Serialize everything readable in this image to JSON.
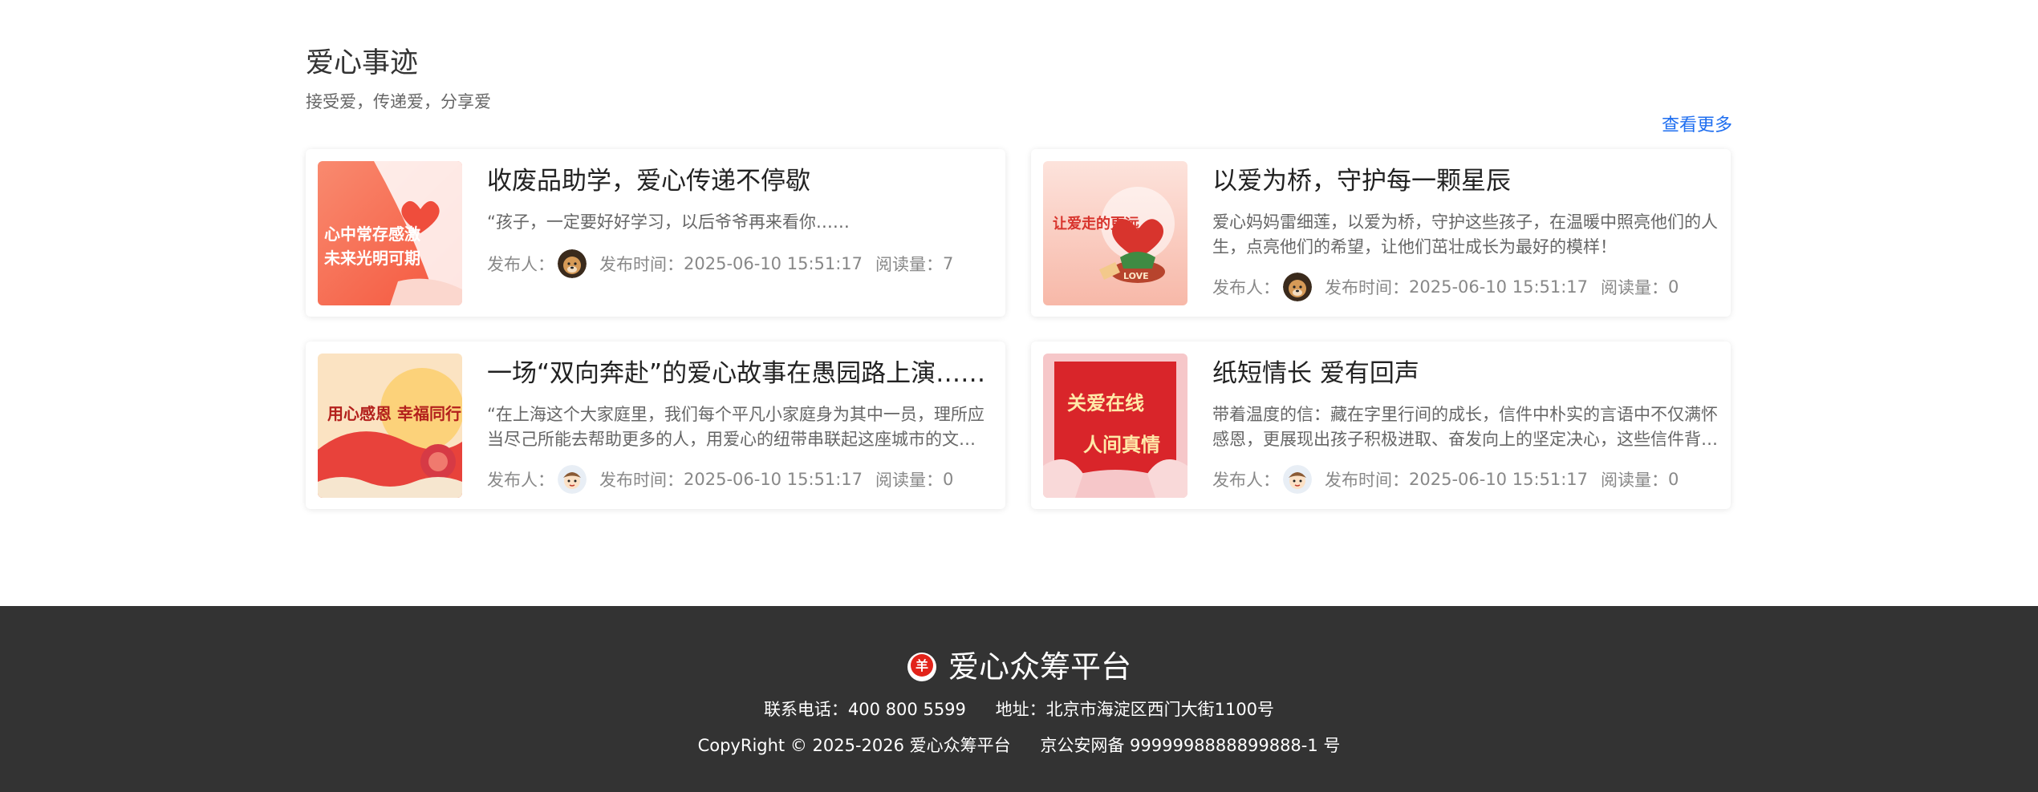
{
  "section": {
    "title": "爱心事迹",
    "subtitle": "接受爱，传递爱，分享爱",
    "more": "查看更多"
  },
  "meta_labels": {
    "author": "发布人：",
    "time": "发布时间：",
    "reads": "阅读量："
  },
  "cards": [
    {
      "title": "收废品助学，爱心传递不停歇",
      "desc": "“孩子，一定要好好学习，以后爷爷再来看你……",
      "time": "2025-06-10 15:51:17",
      "reads": "7",
      "thumb_text": [
        "心中常存感激",
        "未来光明可期"
      ]
    },
    {
      "title": "以爱为桥，守护每一颗星辰",
      "desc": "爱心妈妈雷细莲，以爱为桥，守护这些孩子，在温暖中照亮他们的人生，点亮他们的希望，让他们茁壮成长为最好的模样！",
      "time": "2025-06-10 15:51:17",
      "reads": "0",
      "thumb_text": [
        "让爱走的更远",
        "LOVE"
      ]
    },
    {
      "title": "一场“双向奔赴”的爱心故事在愚园路上演……",
      "desc": "“在上海这个大家庭里，我们每个平凡小家庭身为其中一员，理所应当尽己所能去帮助更多的人，用爱心的纽带串联起这座城市的文明……",
      "time": "2025-06-10 15:51:17",
      "reads": "0",
      "thumb_text": [
        "用心感恩 幸福同行"
      ]
    },
    {
      "title": "纸短情长 爱有回声",
      "desc": "带着温度的信：藏在字里行间的成长，信件中朴实的言语中不仅满怀感恩，更展现出孩子积极进取、奋发向上的坚定决心，这些信件背后……",
      "time": "2025-06-10 15:51:17",
      "reads": "0",
      "thumb_text": [
        "关爱在线",
        "人间真情"
      ]
    }
  ],
  "footer": {
    "logo_glyph": "羊",
    "name": "爱心众筹平台",
    "phone": "联系电话：400 800 5599",
    "address": "地址：北京市海淀区西门大街1100号",
    "copyright": "CopyRight © 2025-2026 爱心众筹平台",
    "icp": "京公安网备 9999998888899888-1 号"
  },
  "colors": {
    "accent_link": "#1e6ef0",
    "footer_bg": "#333333",
    "logo_red": "#e2231a"
  },
  "icons": {
    "author_avatar_1": "dog-avatar-icon",
    "author_avatar_2": "cartoon-avatar-icon"
  }
}
